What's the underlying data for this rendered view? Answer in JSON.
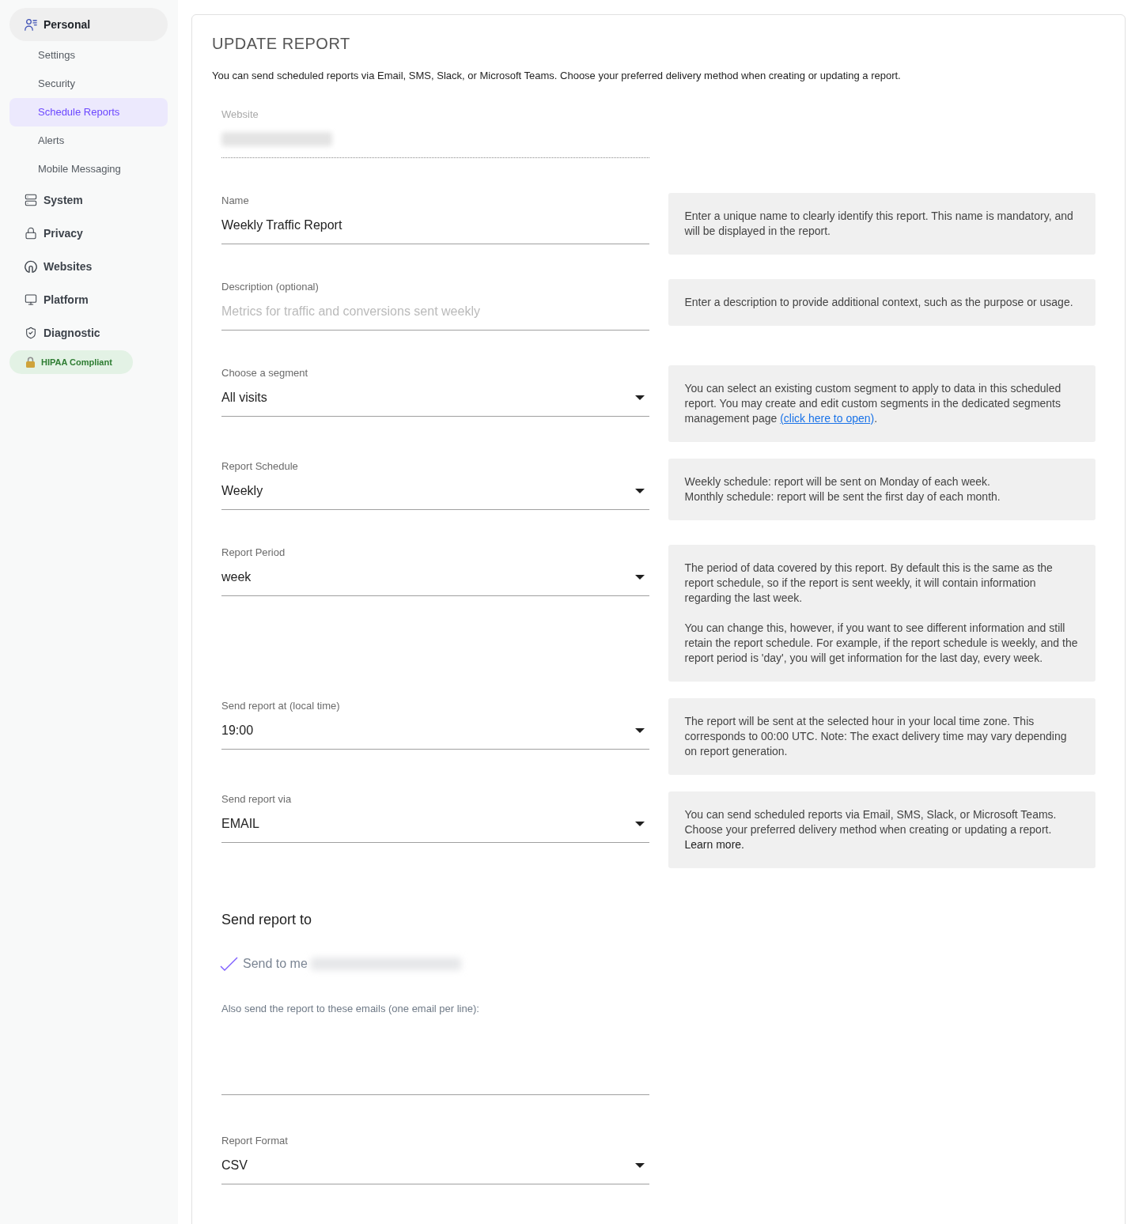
{
  "sidebar": {
    "items": [
      {
        "label": "Personal",
        "expanded": true,
        "children": [
          {
            "label": "Settings",
            "selected": false
          },
          {
            "label": "Security",
            "selected": false
          },
          {
            "label": "Schedule Reports",
            "selected": true
          },
          {
            "label": "Alerts",
            "selected": false
          },
          {
            "label": "Mobile Messaging",
            "selected": false
          }
        ]
      },
      {
        "label": "System",
        "expanded": false
      },
      {
        "label": "Privacy",
        "expanded": false
      },
      {
        "label": "Websites",
        "expanded": false
      },
      {
        "label": "Platform",
        "expanded": false
      },
      {
        "label": "Diagnostic",
        "expanded": false
      }
    ],
    "badge": {
      "label": "HIPAA Compliant"
    }
  },
  "page": {
    "title": "UPDATE REPORT",
    "intro": "You can send scheduled reports via Email, SMS, Slack, or Microsoft Teams. Choose your preferred delivery method when creating or updating a report."
  },
  "fields": [
    {
      "kind": "blurred",
      "label": "Website",
      "disabled": true
    },
    {
      "kind": "text",
      "label": "Name",
      "value": "Weekly Traffic Report",
      "disabled": false,
      "help": [
        {
          "lines": [
            "Enter a unique name to clearly identify this report. This name is mandatory, and will be displayed in the report."
          ]
        }
      ]
    },
    {
      "kind": "text",
      "label": "Description (optional)",
      "placeholder": "Metrics for traffic and conversions sent weekly",
      "disabled": false,
      "help": [
        {
          "lines": [
            "Enter a description to provide additional context, such as the purpose or usage."
          ]
        }
      ]
    },
    {
      "kind": "select",
      "label": "Choose a segment",
      "value": "All visits",
      "disabled": false,
      "help": [
        {
          "lines": [
            "You can select an existing custom segment to apply to data in this scheduled report. You may create and edit custom segments in the dedicated segments management page"
          ],
          "link": {
            "text": "(click here to open)",
            "kind": "underlined",
            "after": "."
          }
        }
      ]
    },
    {
      "kind": "select",
      "label": "Report Schedule",
      "value": "Weekly",
      "disabled": false,
      "help": [
        {
          "lines": [
            "Weekly schedule: report will be sent on Monday of each week.",
            "Monthly schedule: report will be sent the first day of each month."
          ]
        }
      ]
    },
    {
      "kind": "select",
      "label": "Report Period",
      "value": "week",
      "disabled": false,
      "help": [
        {
          "lines": [
            "The period of data covered by this report. By default this is the same as the report schedule, so if the report is sent weekly, it will contain information regarding the last week."
          ]
        },
        {
          "lines": [
            "You can change this, however, if you want to see different information and still retain the report schedule. For example, if the report schedule is weekly, and the report period is 'day', you will get information for the last day, every week."
          ]
        }
      ]
    },
    {
      "kind": "select",
      "label": "Send report at (local time)",
      "value": "19:00",
      "disabled": false,
      "help": [
        {
          "lines": [
            "The report will be sent at the selected hour in your local time zone. This corresponds to 00:00 UTC. Note: The exact delivery time may vary depending on report generation."
          ]
        }
      ]
    },
    {
      "kind": "select",
      "label": "Send report via",
      "value": "EMAIL",
      "disabled": false,
      "help": [
        {
          "lines": [
            "You can send scheduled reports via Email, SMS, Slack, or Microsoft Teams. Choose your preferred delivery method when creating or updating a report."
          ],
          "link": {
            "text": "Learn more.",
            "kind": "plain"
          }
        }
      ]
    }
  ],
  "recipients": {
    "heading": "Send report to",
    "send_to_me": {
      "label": "Send to me",
      "checked": true
    },
    "also_label": "Also send the report to these emails (one email per line):"
  },
  "more_fields": [
    {
      "kind": "select",
      "label": "Report Format",
      "value": "CSV",
      "disabled": false
    }
  ]
}
